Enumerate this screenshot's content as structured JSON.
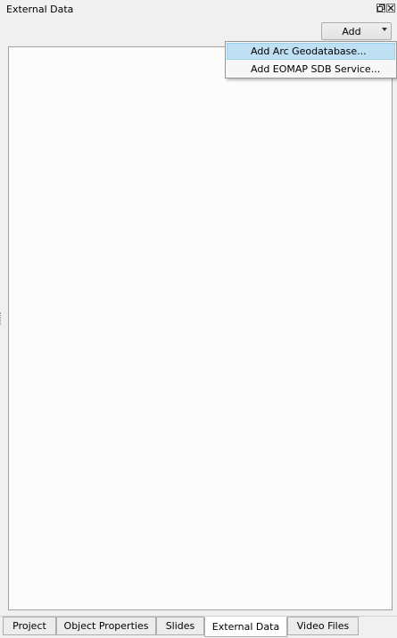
{
  "panel": {
    "title": "External Data"
  },
  "title_buttons": {
    "float_icon": "float-restore-icon",
    "close_icon": "close-icon"
  },
  "toolbar": {
    "add_label": "Add",
    "add_arrow_icon": "dropdown-arrow-icon"
  },
  "dropdown": {
    "items": [
      {
        "label": "Add Arc Geodatabase...",
        "highlighted": true
      },
      {
        "label": "Add EOMAP SDB Service...",
        "highlighted": false
      }
    ]
  },
  "tabs": [
    {
      "label": "Project",
      "active": false
    },
    {
      "label": "Object Properties",
      "active": false
    },
    {
      "label": "Slides",
      "active": false
    },
    {
      "label": "External Data",
      "active": true
    },
    {
      "label": "Video Files",
      "active": false
    }
  ],
  "colors": {
    "menu_highlight": "#bfe0f2",
    "panel_bg": "#f0f0f0",
    "content_bg": "#fcfcfc"
  }
}
